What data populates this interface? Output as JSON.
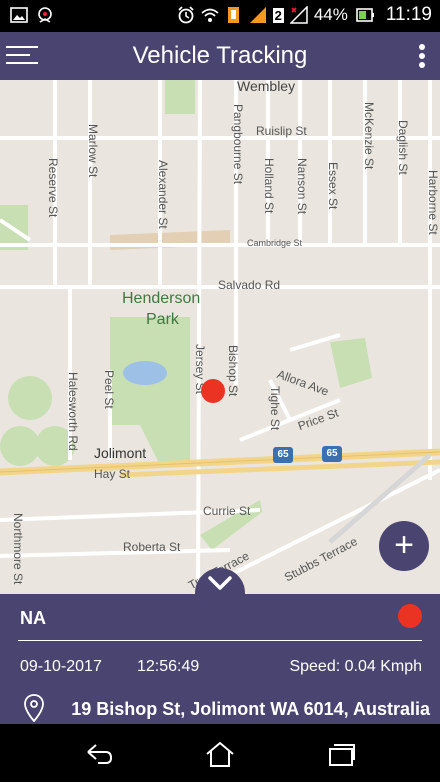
{
  "status_bar": {
    "battery_percent": "44%",
    "time": "11:19",
    "sim_slot": "2",
    "icons": [
      "image-icon",
      "notification-icon",
      "alarm-icon",
      "wifi-icon",
      "data-icon",
      "signal-icon",
      "battery-icon"
    ]
  },
  "app_bar": {
    "title": "Vehicle Tracking",
    "menu_icon": "hamburger-icon",
    "overflow_icon": "more-vert-icon"
  },
  "map": {
    "streets": {
      "wembley": "Wembley",
      "ruislip": "Ruislip St",
      "reserve": "Reserve St",
      "marlow": "Marlow St",
      "alexander": "Alexander St",
      "pangbourne": "Pangbourne St",
      "holland": "Holland St",
      "nanson": "Nanson St",
      "essex": "Essex St",
      "mckenzie": "McKenzie St",
      "daglish": "Daglish St",
      "harborne": "Harborne St",
      "cambridge": "Cambridge St",
      "salvado": "Salvado Rd",
      "henderson": "Henderson",
      "park": "Park",
      "jersey": "Jersey St",
      "bishop": "Bishop St",
      "allora": "Allora Ave",
      "halesworth": "Halesworth Rd",
      "peel": "Peel St",
      "tighe": "Tighe St",
      "price": "Price St",
      "jolimont": "Jolimont",
      "hay": "Hay St",
      "hwy1": "65",
      "hwy2": "65",
      "currie": "Currie St",
      "northmore": "Northmore St",
      "roberta": "Roberta St",
      "troy": "Troy Terrace",
      "stubbs": "Stubbs Terrace"
    },
    "fab_label": "+",
    "colors": {
      "map_bg": "#eae6df",
      "park": "#c8dfb3",
      "road": "#ffffff",
      "highway": "#f3d58a",
      "water": "#9cc0e6",
      "marker": "#ea3323"
    }
  },
  "info_panel": {
    "vehicle_name": "NA",
    "date": "09-10-2017",
    "time": "12:56:49",
    "speed": "Speed: 0.04 Kmph",
    "address": "19 Bishop St, Jolimont WA 6014, Australia",
    "status_color": "#ea3323",
    "accent": "#4a4570"
  },
  "nav_bar": {
    "back_icon": "back-icon",
    "home_icon": "home-icon",
    "recents_icon": "recents-icon"
  }
}
